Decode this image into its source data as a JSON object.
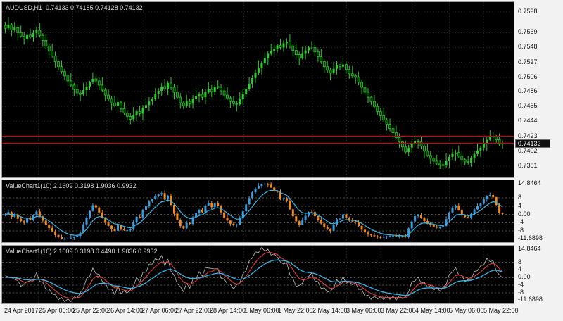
{
  "window": {
    "bg": "#f2f2f2"
  },
  "main_chart": {
    "info_label": "AUDUSD,H1  0.74133 0.74185 0.74128 0.74132",
    "symbol": "AUDUSD",
    "timeframe": "H1",
    "ohlc": {
      "open": "0.74133",
      "high": "0.74185",
      "low": "0.74128",
      "close": "0.74132"
    },
    "current_price": "0.74132"
  },
  "indicator1": {
    "label": "ValueChart1(10) 2.1609 0.3198 1.9036 0.9932"
  },
  "indicator2": {
    "label": "ValueChart1(10) 2.1609 0.3198 0.4490 1.9036 0.9932"
  },
  "time_axis": {
    "labels": [
      "24 Apr 2017",
      "25 Apr 06:00",
      "25 Apr 22:00",
      "26 Apr 14:00",
      "27 Apr 06:00",
      "27 Apr 22:00",
      "28 Apr 14:00",
      "1 May 06:00",
      "1 May 22:00",
      "2 May 14:00",
      "3 May 06:00",
      "3 May 22:00",
      "4 May 14:00",
      "5 May 06:00",
      "5 May 22:00"
    ]
  },
  "colors": {
    "panel_bg": "#000000",
    "frame_bg": "#f2f2f2",
    "grid": "#2e2e2e",
    "candle_up": "#2ecc2e",
    "candle_down_fill": "#003c00",
    "candle": "#2ecc2e",
    "red_line": "#d40000",
    "bid_box_bg": "#101010",
    "axis_text": "#111111",
    "overlay_text": "#dcdcdc",
    "vc_up": "#3f9bdc",
    "vc_down": "#ef8a1f",
    "vc_ma": "#37b6e8",
    "line_gray": "#bdbdbd",
    "line_red": "#e23b3b",
    "line_blue": "#37b6e8",
    "level_line": "#565647"
  },
  "chart_data": [
    {
      "id": "price",
      "type": "candlestick",
      "title": "AUDUSD H1",
      "y_axis_labels": [
        "0.7598",
        "0.7569",
        "0.7548",
        "0.7527",
        "0.7506",
        "0.7486",
        "0.7465",
        "0.7444",
        "0.7423",
        "0.7402",
        "0.7381"
      ],
      "y_top": 0.7598,
      "y_bottom": 0.7381,
      "bid": 0.74132,
      "hline": 0.7423,
      "closes": [
        0.7575,
        0.758,
        0.7573,
        0.7576,
        0.7569,
        0.7564,
        0.756,
        0.75655,
        0.75625,
        0.75685,
        0.7572,
        0.7565,
        0.7558,
        0.755,
        0.7543,
        0.7536,
        0.7528,
        0.7521,
        0.7514,
        0.7508,
        0.7501,
        0.7495,
        0.7489,
        0.7484,
        0.7482,
        0.7488,
        0.7493,
        0.7499,
        0.7504,
        0.7501,
        0.7495,
        0.7488,
        0.7481,
        0.7476,
        0.747,
        0.7466,
        0.7471,
        0.7462,
        0.7456,
        0.7451,
        0.7447,
        0.7453,
        0.7458,
        0.7455,
        0.7463,
        0.7467,
        0.7472,
        0.7476,
        0.7482,
        0.7487,
        0.7493,
        0.749,
        0.7498,
        0.7492,
        0.7485,
        0.7478,
        0.747,
        0.7466,
        0.7472,
        0.7469,
        0.7476,
        0.748,
        0.7482,
        0.7478,
        0.7485,
        0.7489,
        0.7486,
        0.7493,
        0.7492,
        0.7487,
        0.7481,
        0.7477,
        0.7472,
        0.7469,
        0.7468,
        0.7475,
        0.7483,
        0.749,
        0.7497,
        0.7505,
        0.7512,
        0.7519,
        0.7526,
        0.7533,
        0.7539,
        0.7543,
        0.7546,
        0.7551,
        0.7548,
        0.7554,
        0.7556,
        0.755,
        0.7544,
        0.7538,
        0.7533,
        0.7539,
        0.7544,
        0.7548,
        0.7548,
        0.7542,
        0.7535,
        0.7528,
        0.7521,
        0.7516,
        0.7512,
        0.7518,
        0.7523,
        0.7521,
        0.7524,
        0.7517,
        0.7511,
        0.7508,
        0.7506,
        0.7499,
        0.7492,
        0.7485,
        0.7478,
        0.7472,
        0.7465,
        0.7458,
        0.7452,
        0.7446,
        0.744,
        0.7434,
        0.7428,
        0.7421,
        0.7415,
        0.7408,
        0.7401,
        0.7407,
        0.7412,
        0.7416,
        0.7415,
        0.7409,
        0.7402,
        0.7396,
        0.7392,
        0.7388,
        0.7385,
        0.7383,
        0.7382,
        0.7388,
        0.7394,
        0.7398,
        0.74,
        0.7395,
        0.739,
        0.7387,
        0.7386,
        0.7392,
        0.7398,
        0.7403,
        0.7407,
        0.7413,
        0.7418,
        0.7422,
        0.7423,
        0.7418,
        0.7412,
        0.74132
      ],
      "wick_high": [
        0.0005,
        0.0011,
        0.0003,
        0.0008,
        0.0004,
        0.001,
        0.0006,
        0.0002,
        0.0009,
        0.0004
      ],
      "wick_low": [
        0.0007,
        0.0003,
        0.0009,
        0.0004,
        0.001,
        0.0002,
        0.0008,
        0.0005,
        0.0003,
        0.0006
      ]
    },
    {
      "id": "valuechart_bars",
      "type": "bar",
      "name": "ValueChart1",
      "period": 10,
      "display_values": [
        "2.1609",
        "0.3198",
        "1.9036",
        "0.9932"
      ],
      "y_max": 14.8464,
      "y_min": -11.6898,
      "sma_period": 10,
      "ma_period": 8,
      "levels": [
        8,
        4,
        0,
        -4,
        -8
      ],
      "axis_labels": [
        {
          "t": "14.8464",
          "v": 14.8464
        },
        {
          "t": "8",
          "v": 8
        },
        {
          "t": "4",
          "v": 4
        },
        {
          "t": "0.00",
          "v": 0
        },
        {
          "t": "-4",
          "v": -4
        },
        {
          "t": "-8",
          "v": -8
        },
        {
          "t": "-11.6898",
          "v": -11.6898
        }
      ]
    },
    {
      "id": "valuechart_lines",
      "type": "line",
      "name": "ValueChart1",
      "period": 10,
      "display_values": [
        "2.1609",
        "0.3198",
        "0.4490",
        "1.9036",
        "0.9932"
      ],
      "y_max": 14.8464,
      "y_min": -11.6898,
      "ema_fast": 5,
      "ema_slow": 15,
      "jitter": [
        0.9,
        -0.7,
        1.2,
        -1.0,
        0.5,
        -1.3,
        0.8,
        -0.4
      ],
      "levels": [
        8,
        4,
        0,
        -4,
        -8
      ],
      "axis_labels": [
        {
          "t": "14.8464",
          "v": 14.8464
        },
        {
          "t": "8",
          "v": 8
        },
        {
          "t": "4",
          "v": 4
        },
        {
          "t": "0.00",
          "v": 0
        },
        {
          "t": "-4",
          "v": -4
        },
        {
          "t": "-8",
          "v": -8
        },
        {
          "t": "-11.6898",
          "v": -11.6898
        }
      ]
    }
  ]
}
